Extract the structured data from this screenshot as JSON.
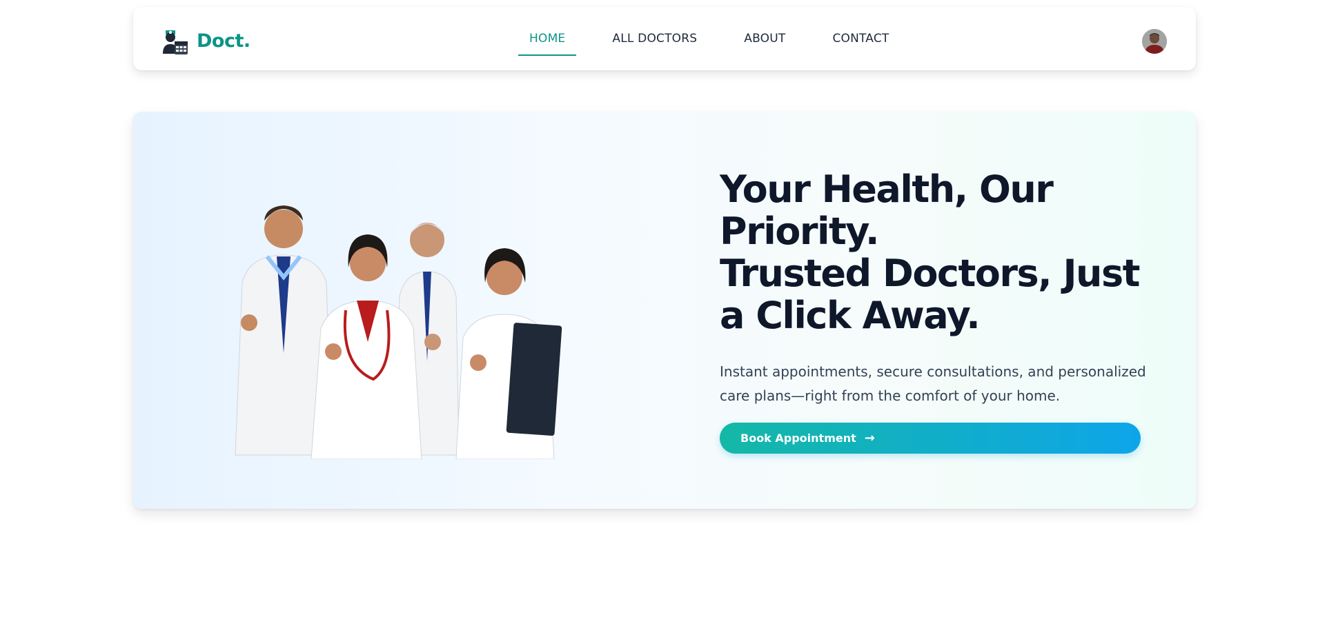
{
  "brand": {
    "name": "Doct.",
    "logo_icon": "doctor-calendar-icon",
    "color": "#0d9488"
  },
  "nav": {
    "items": [
      {
        "label": "HOME",
        "active": true
      },
      {
        "label": "ALL DOCTORS",
        "active": false
      },
      {
        "label": "ABOUT",
        "active": false
      },
      {
        "label": "CONTACT",
        "active": false
      }
    ],
    "avatar_icon": "user-avatar"
  },
  "hero": {
    "title_line1": "Your Health, Our",
    "title_line2": "Priority.",
    "title_line3": "Trusted Doctors, Just",
    "title_line4": "a Click Away.",
    "description": "Instant appointments, secure consultations, and personalized care plans—right from the comfort of your home.",
    "cta_label": "Book Appointment",
    "cta_icon": "arrow-right-icon",
    "image_icon": "doctors-group-illustration"
  },
  "colors": {
    "accent": "#0d9488",
    "cta_start": "#14b8a6",
    "cta_end": "#0ea5e9",
    "text": "#0f172a"
  }
}
